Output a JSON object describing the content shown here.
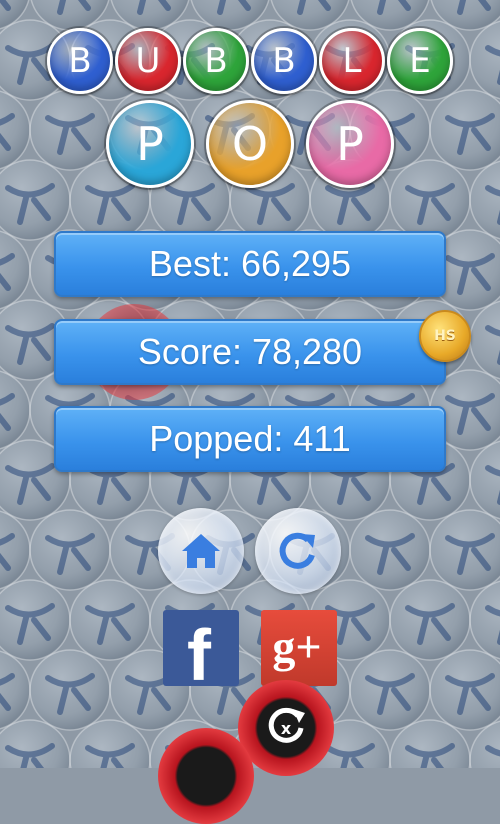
{
  "title": {
    "word1": [
      {
        "letter": "B",
        "color": "#2f5fd0"
      },
      {
        "letter": "U",
        "color": "#d9262e"
      },
      {
        "letter": "B",
        "color": "#2ea43a"
      },
      {
        "letter": "B",
        "color": "#2f5fd0"
      },
      {
        "letter": "L",
        "color": "#d9262e"
      },
      {
        "letter": "E",
        "color": "#2ea43a"
      }
    ],
    "word2": [
      {
        "letter": "P",
        "color": "#2aa6d8"
      },
      {
        "letter": "O",
        "color": "#e8a12a"
      },
      {
        "letter": "P",
        "color": "#e86aa6"
      }
    ]
  },
  "stats": {
    "best": "Best: 66,295",
    "score": "Score: 78,280",
    "popped": "Popped: 411"
  },
  "badge": {
    "label": "HS",
    "icon": "high-score-coin-icon"
  },
  "buttons": {
    "home": {
      "icon": "home-icon",
      "color": "#3a7ee0"
    },
    "replay": {
      "icon": "replay-icon",
      "color": "#3a7ee0"
    },
    "facebook": {
      "icon": "facebook-icon",
      "glyph": "f",
      "color": "#3b5998"
    },
    "google_plus": {
      "icon": "google-plus-icon",
      "glyph": "g+",
      "color": "#d8392c"
    },
    "quit": {
      "icon": "quit-icon",
      "glyph": "x"
    }
  }
}
